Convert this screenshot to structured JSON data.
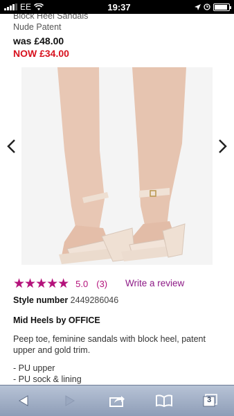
{
  "status_bar": {
    "carrier": "EE",
    "time": "19:37"
  },
  "product": {
    "name_line1": "Block Heel Sandals",
    "name_line2": "Nude Patent",
    "was_price": "was £48.00",
    "now_price": "NOW £34.00",
    "image_alt": "nude patent block heel sandals"
  },
  "rating": {
    "stars": "★★★★★",
    "score": "5.0",
    "count": "(3)",
    "write_review": "Write a review"
  },
  "details": {
    "style_label": "Style number",
    "style_number": "2449286046",
    "brand_line": "Mid Heels by OFFICE",
    "description": "Peep toe, feminine sandals with block heel, patent upper and gold trim.",
    "features": [
      "- PU upper",
      "- PU sock & lining"
    ]
  },
  "toolbar": {
    "tabs_count": "3"
  },
  "colors": {
    "price_now": "#d8121f",
    "rating_accent": "#b4127b",
    "toolbar": "#a7b4ca"
  }
}
